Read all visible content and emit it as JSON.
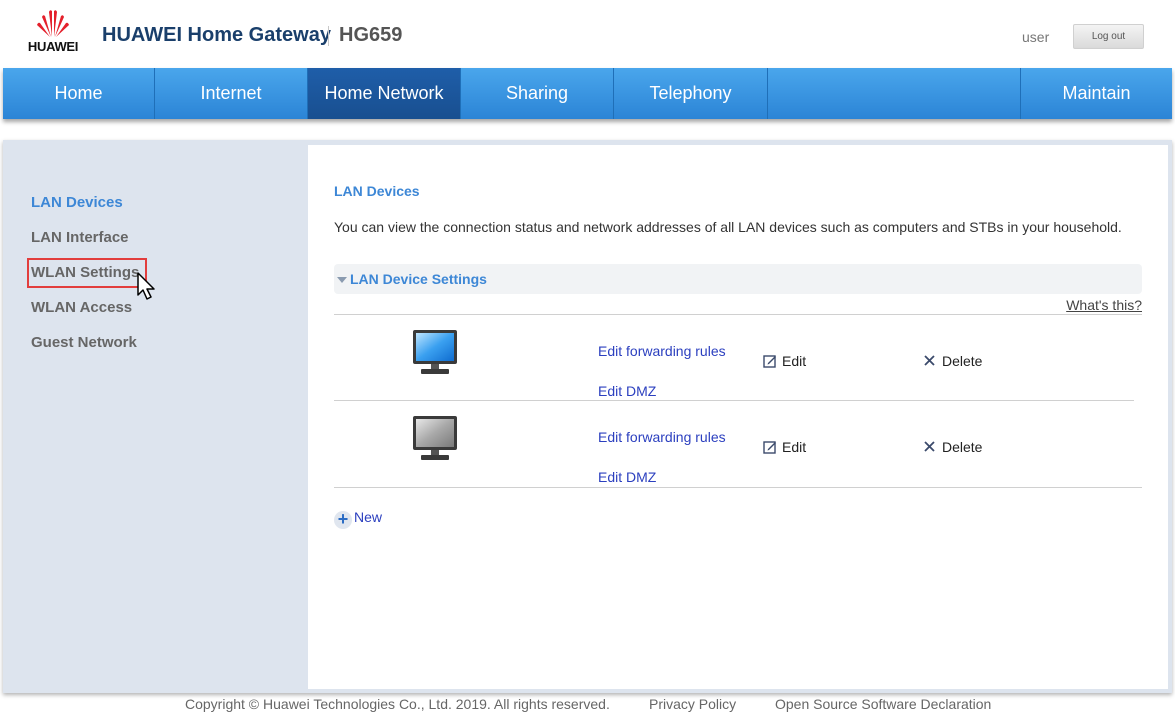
{
  "header": {
    "brand": "HUAWEI",
    "title": "HUAWEI Home Gateway",
    "model": "HG659",
    "user": "user",
    "logout_label": "Log out"
  },
  "nav": {
    "items": [
      {
        "label": "Home"
      },
      {
        "label": "Internet"
      },
      {
        "label": "Home Network"
      },
      {
        "label": "Sharing"
      },
      {
        "label": "Telephony"
      },
      {
        "label": "Maintain"
      }
    ],
    "active": "Home Network"
  },
  "sidebar": {
    "items": [
      {
        "label": "LAN Devices"
      },
      {
        "label": "LAN Interface"
      },
      {
        "label": "WLAN Settings"
      },
      {
        "label": "WLAN Access"
      },
      {
        "label": "Guest Network"
      }
    ],
    "active": "LAN Devices",
    "highlighted": "WLAN Settings"
  },
  "content": {
    "title": "LAN Devices",
    "description": "You can view the connection status and network addresses of all LAN devices such as computers and STBs in your household.",
    "section_title": "LAN Device Settings",
    "whats_this": "What's this?",
    "devices": [
      {
        "icon": "monitor-online-icon",
        "forward_label": "Edit forwarding rules",
        "dmz_label": "Edit DMZ",
        "edit_label": "Edit",
        "delete_label": "Delete"
      },
      {
        "icon": "monitor-offline-icon",
        "forward_label": "Edit forwarding rules",
        "dmz_label": "Edit DMZ",
        "edit_label": "Edit",
        "delete_label": "Delete"
      }
    ],
    "new_label": "New"
  },
  "footer": {
    "copyright": "Copyright © Huawei Technologies Co., Ltd. 2019. All rights reserved.",
    "privacy": "Privacy Policy",
    "open_source": "Open Source Software Declaration"
  },
  "colors": {
    "nav_blue": "#2b84d6",
    "nav_active": "#1f5ea9",
    "link_blue": "#3d87d6",
    "highlight_red": "#e23d3d"
  }
}
